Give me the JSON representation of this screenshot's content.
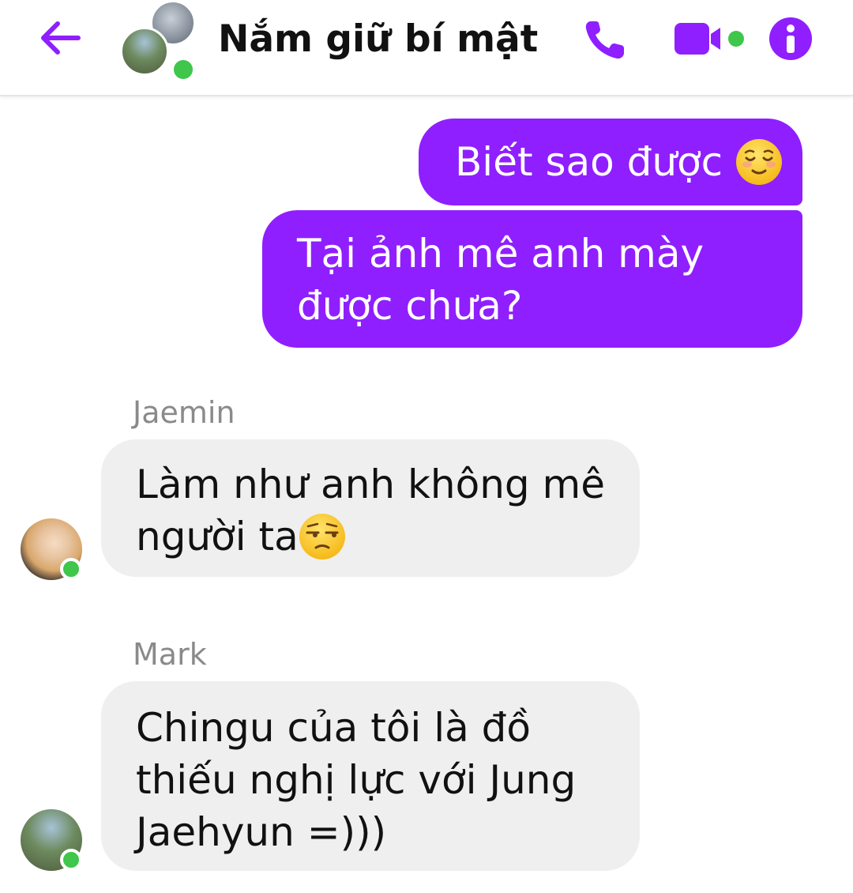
{
  "header": {
    "title": "Nắm giữ bí mật",
    "back_icon": "arrow-left-icon",
    "call_icon": "phone-icon",
    "video_icon": "video-camera-icon",
    "info_icon": "info-icon",
    "accent_color": "#8f1fff",
    "online_color": "#3fc64b"
  },
  "messages": [
    {
      "direction": "outgoing",
      "text": "Biết sao được ",
      "emoji": "relieved-face-emoji"
    },
    {
      "direction": "outgoing",
      "lines": [
        "Tại ảnh mê anh mày",
        "được chưa?"
      ]
    },
    {
      "direction": "incoming",
      "sender": "Jaemin",
      "lines": [
        "Làm như anh không mê",
        "người ta"
      ],
      "emoji": "unamused-face-emoji"
    },
    {
      "direction": "incoming",
      "sender": "Mark",
      "lines": [
        "Chingu của tôi là đồ",
        "thiếu nghị lực với Jung",
        "Jaehyun =)))"
      ]
    }
  ]
}
